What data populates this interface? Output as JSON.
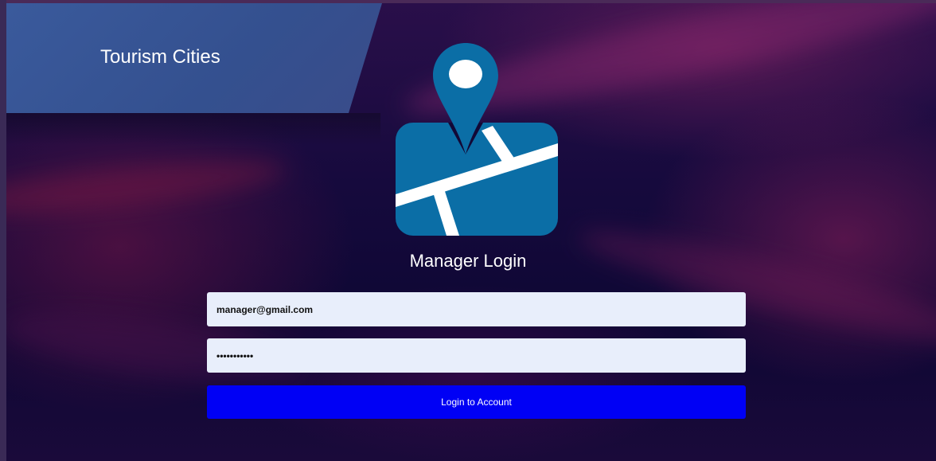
{
  "header": {
    "brand_title": "Tourism Cities"
  },
  "logo": {
    "icon": "map-location-pin-icon",
    "colors": {
      "primary": "#0b6ea6",
      "road": "#ffffff"
    }
  },
  "login_form": {
    "title": "Manager Login",
    "email": {
      "value": "manager@gmail.com"
    },
    "password": {
      "masked_value": "•••••••••••"
    },
    "submit_label": "Login to Account"
  },
  "theme": {
    "input_background": "#e8eefb",
    "button_color": "#0000f5",
    "banner_color": "#3a5a9c"
  }
}
